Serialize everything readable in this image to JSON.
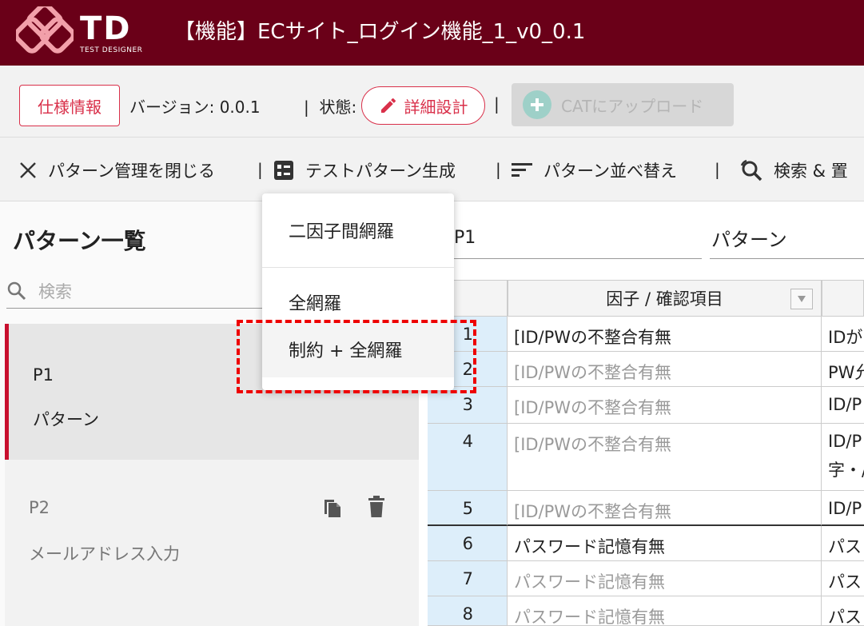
{
  "header": {
    "logo_text": "TD",
    "logo_sub": "TEST DESIGNER",
    "title": "【機能】ECサイト_ログイン機能_1_v0_0.1"
  },
  "infobar": {
    "spec_button": "仕様情報",
    "version": "バージョン: 0.0.1",
    "separator": "|",
    "state_label": "状態:",
    "state_button": "詳細設計",
    "cat_button": "CATにアップロード"
  },
  "toolbar": {
    "close": "パターン管理を閉じる",
    "generate": "テストパターン生成",
    "sort": "パターン並べ替え",
    "search_replace": "検索 & 置"
  },
  "pattern_list": {
    "title": "パターン一覧",
    "search_placeholder": "検索",
    "items": [
      {
        "id": "P1",
        "name": "パターン"
      },
      {
        "id": "P2",
        "name": "メールアドレス入力"
      }
    ]
  },
  "detail": {
    "pattern_id": "P1",
    "pattern_name": "パターン",
    "factor_header": "因子 / 確認項目",
    "rows": [
      {
        "no": "1",
        "factor": "[ID/PWの不整合有無",
        "value": "IDが"
      },
      {
        "no": "2",
        "factor": "[ID/PWの不整合有無",
        "value": "PW允"
      },
      {
        "no": "3",
        "factor": "[ID/PWの不整合有無",
        "value": "ID/P"
      },
      {
        "no": "4",
        "factor": "[ID/PWの不整合有無",
        "value": "ID/P",
        "value2": "字・/"
      },
      {
        "no": "5",
        "factor": "[ID/PWの不整合有無",
        "value": "ID/P"
      },
      {
        "no": "6",
        "factor": "パスワード記憶有無",
        "value": "パス"
      },
      {
        "no": "7",
        "factor": "パスワード記憶有無",
        "value": "パス"
      },
      {
        "no": "8",
        "factor": "パスワード記憶有無",
        "value": "パス"
      }
    ]
  },
  "menu": {
    "items": [
      "二因子間網羅",
      "全網羅",
      "制約 + 全網羅"
    ]
  },
  "colors": {
    "header_bg": "#6a0018",
    "accent": "#d9304a",
    "selected_bar": "#c8102e",
    "highlight": "#e00000"
  }
}
